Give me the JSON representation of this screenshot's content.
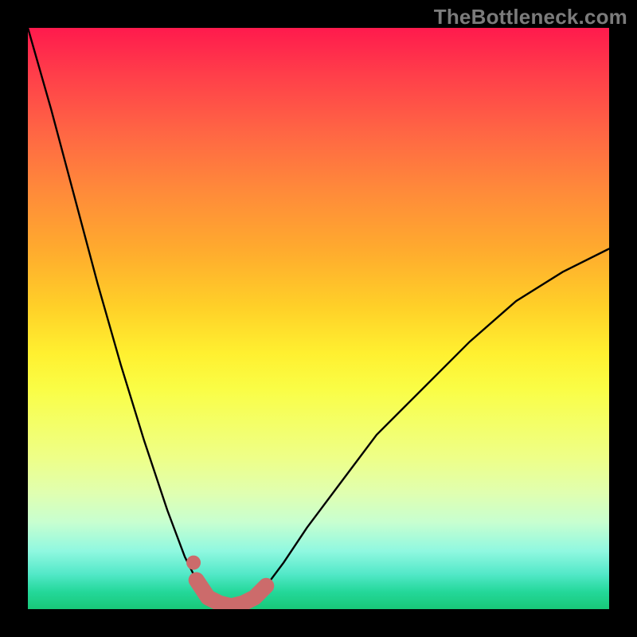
{
  "watermark": "TheBottleneck.com",
  "colors": {
    "background": "#000000",
    "curve": "#000000",
    "marker": "#cc6b6b",
    "gradient_top": "#ff1a4d",
    "gradient_bottom": "#18c878"
  },
  "chart_data": {
    "type": "line",
    "title": "",
    "xlabel": "",
    "ylabel": "",
    "xlim": [
      0,
      100
    ],
    "ylim": [
      0,
      100
    ],
    "grid": false,
    "series": [
      {
        "name": "bottleneck-curve",
        "x": [
          0,
          4,
          8,
          12,
          16,
          20,
          24,
          27,
          29,
          31,
          33,
          35,
          37,
          39,
          41,
          44,
          48,
          54,
          60,
          68,
          76,
          84,
          92,
          100
        ],
        "y": [
          100,
          86,
          71,
          56,
          42,
          29,
          17,
          9,
          5,
          2,
          1,
          0.5,
          1,
          2,
          4,
          8,
          14,
          22,
          30,
          38,
          46,
          53,
          58,
          62
        ]
      },
      {
        "name": "optimal-zone-marker",
        "x": [
          29,
          31,
          33,
          35,
          37,
          39,
          41
        ],
        "y": [
          5,
          2,
          1,
          0.5,
          1,
          2,
          4
        ]
      }
    ]
  }
}
